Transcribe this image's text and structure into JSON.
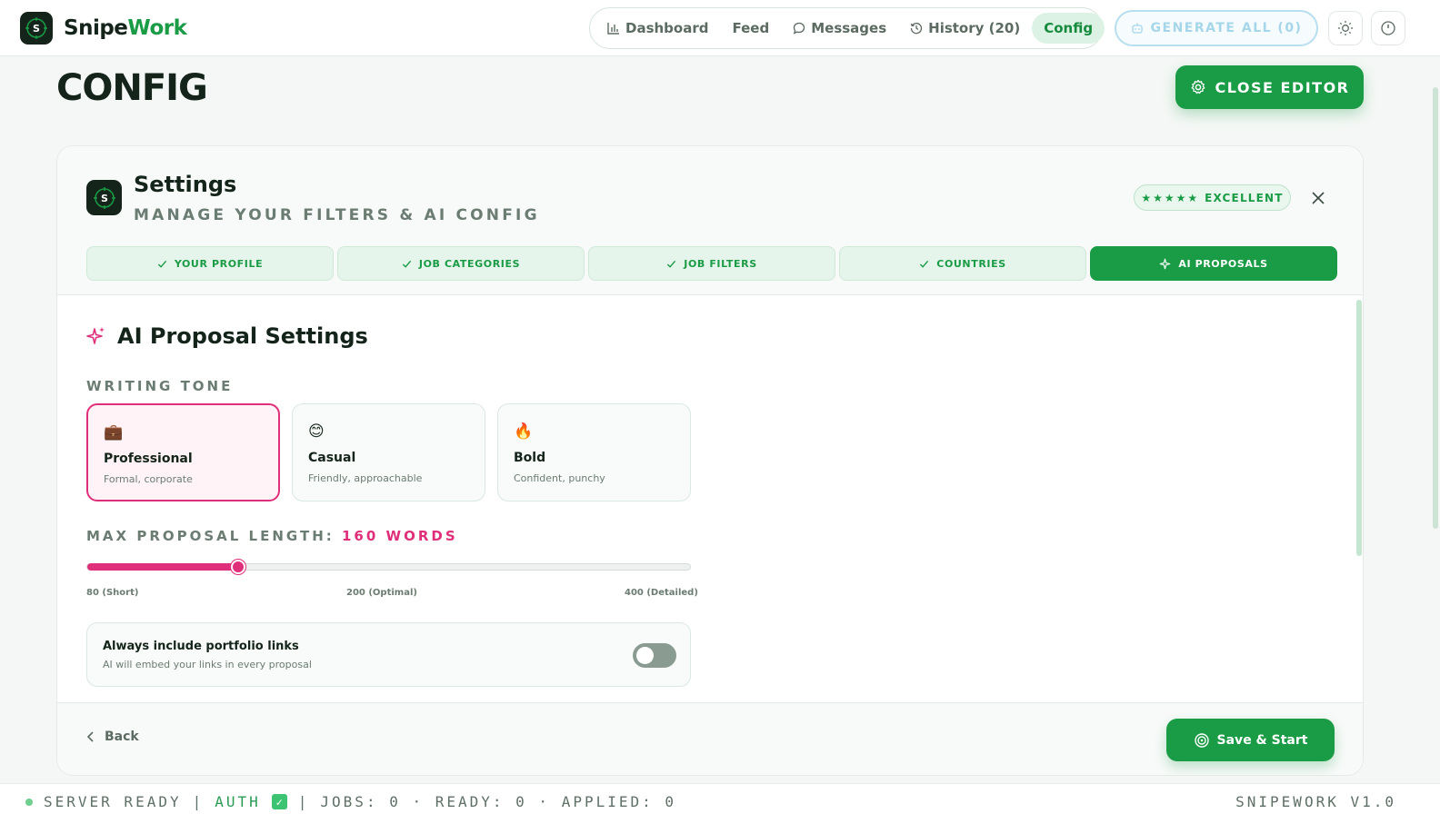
{
  "app": {
    "name_part1": "Snipe",
    "name_part2": "Work",
    "logo_letter": "S"
  },
  "nav": {
    "items": [
      {
        "label": "Dashboard",
        "icon": "bar-chart-icon"
      },
      {
        "label": "Feed",
        "icon": ""
      },
      {
        "label": "Messages",
        "icon": "chat-bubble-icon"
      },
      {
        "label": "History (20)",
        "icon": "history-icon"
      },
      {
        "label": "Config",
        "icon": "",
        "active": true
      }
    ],
    "generate_all_label": "GENERATE ALL (0)",
    "theme_icon": "sun-icon",
    "power_icon": "power-icon"
  },
  "page": {
    "title": "CONFIG",
    "close_editor_label": "CLOSE EDITOR"
  },
  "settings": {
    "title": "Settings",
    "subtitle": "MANAGE YOUR FILTERS & AI CONFIG",
    "rating_stars": "★★★★★",
    "rating_label": "EXCELLENT",
    "tabs": [
      {
        "label": "YOUR PROFILE",
        "done": true
      },
      {
        "label": "JOB CATEGORIES",
        "done": true
      },
      {
        "label": "JOB FILTERS",
        "done": true
      },
      {
        "label": "COUNTRIES",
        "done": true
      },
      {
        "label": "AI PROPOSALS",
        "active": true
      }
    ]
  },
  "ai_proposals": {
    "section_title": "AI Proposal Settings",
    "tone_label": "WRITING TONE",
    "tones": [
      {
        "emoji": "💼",
        "name": "Professional",
        "desc": "Formal, corporate",
        "selected": true
      },
      {
        "emoji": "😊",
        "name": "Casual",
        "desc": "Friendly, approachable",
        "selected": false
      },
      {
        "emoji": "🔥",
        "name": "Bold",
        "desc": "Confident, punchy",
        "selected": false
      }
    ],
    "length_label": "MAX PROPOSAL LENGTH:",
    "length_value": "160 WORDS",
    "slider": {
      "min": 80,
      "max": 400,
      "value": 160
    },
    "ticks": [
      "80 (Short)",
      "200 (Optimal)",
      "400 (Detailed)"
    ],
    "portfolio_title": "Always include portfolio links",
    "portfolio_desc": "AI will embed your links in every proposal",
    "portfolio_enabled": false
  },
  "footer": {
    "back_label": "Back",
    "save_label": "Save & Start"
  },
  "status": {
    "server": "SERVER READY",
    "sep1": "|",
    "auth": "AUTH",
    "sep2": "|",
    "counts": "JOBS: 0 · READY: 0 · APPLIED: 0",
    "version": "SNIPEWORK V1.0"
  },
  "colors": {
    "accent": "#1a9b45",
    "pink": "#e02f7a",
    "dark": "#14241a"
  }
}
